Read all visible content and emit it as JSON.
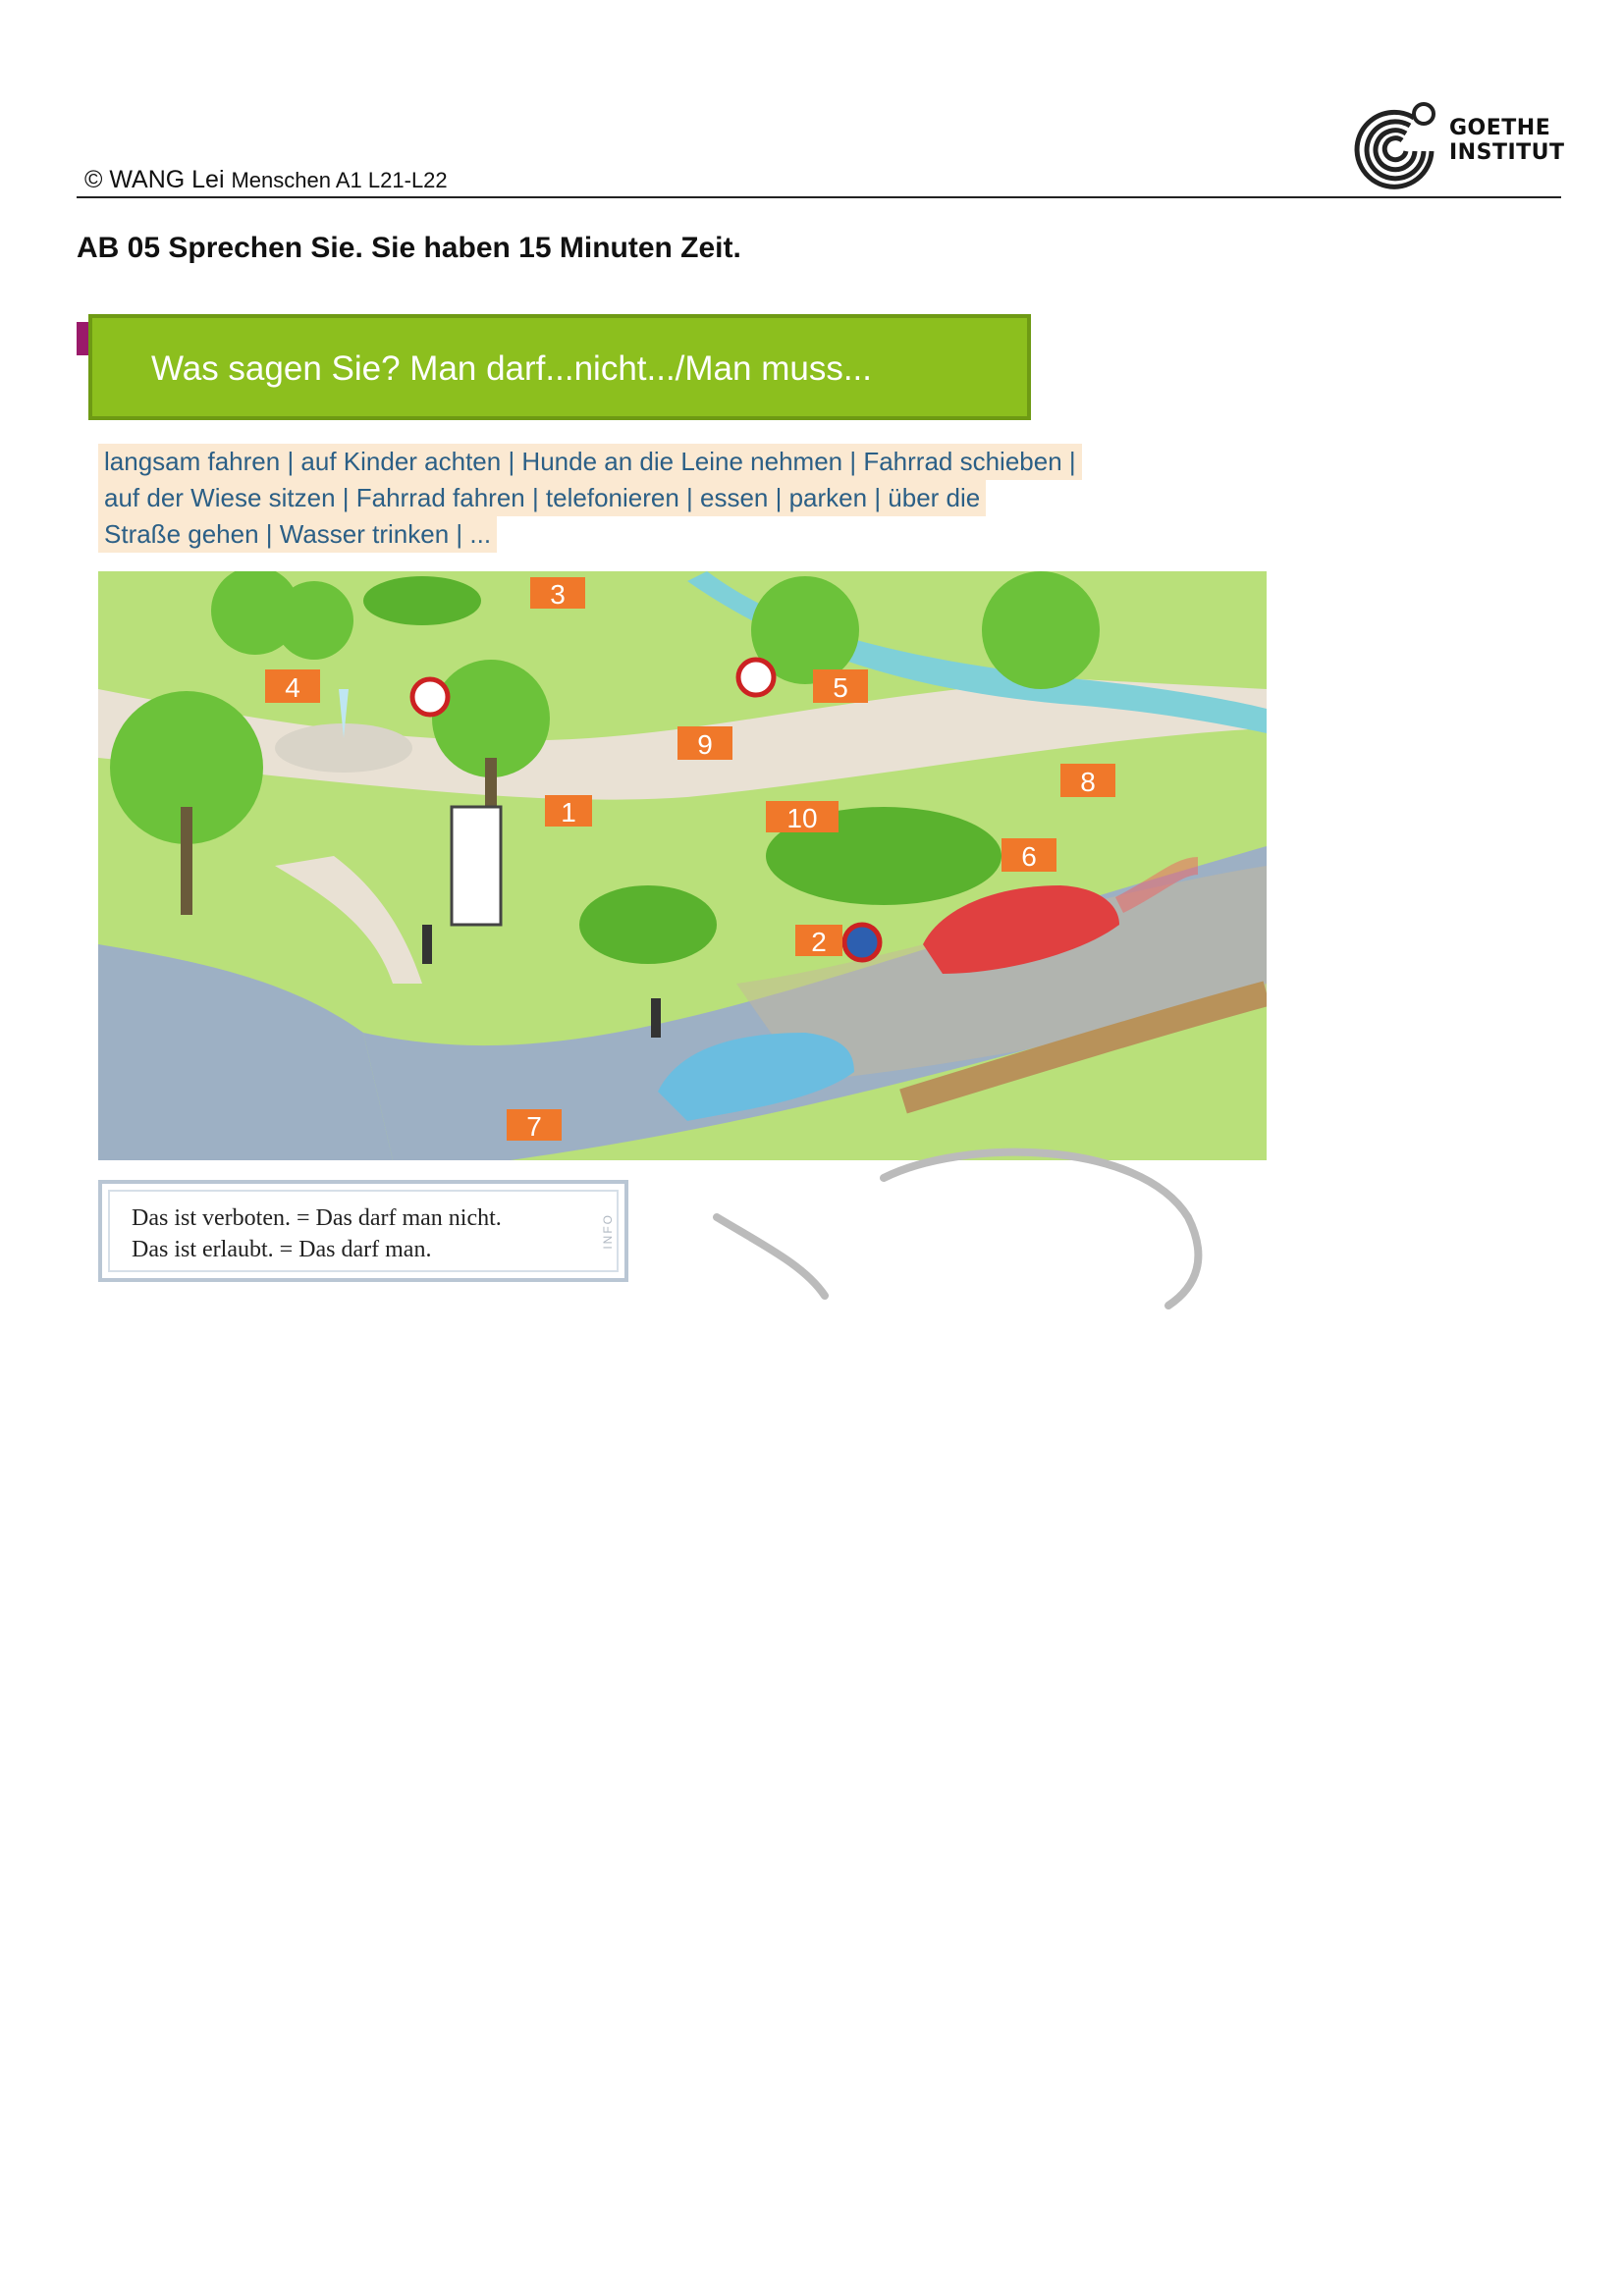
{
  "header": {
    "copyright": "© WANG Lei",
    "course": "Menschen A1 L21-L22",
    "logo_line1": "GOETHE",
    "logo_line2": "INSTITUT"
  },
  "task": {
    "title": "AB 05 Sprechen Sie. Sie haben 15 Minuten Zeit."
  },
  "banner": {
    "text": "Was sagen Sie? Man darf...nicht.../Man muss..."
  },
  "vocab": {
    "lines": [
      "langsam fahren | auf Kinder achten | Hunde an die Leine nehmen | Fahrrad schieben |",
      "auf der Wiese sitzen | Fahrrad fahren | telefonieren | essen | parken | über die",
      "Straße gehen | Wasser trinken | ..."
    ]
  },
  "scene": {
    "labels": [
      "1",
      "2",
      "3",
      "4",
      "5",
      "6",
      "7",
      "8",
      "9",
      "10"
    ]
  },
  "info": {
    "line1": "Das ist verboten. = Das darf man nicht.",
    "line2": "Das ist erlaubt. = Das darf man.",
    "tag": "INFO"
  },
  "colors": {
    "banner_green": "#8cbf1e",
    "label_orange": "#f0782a",
    "vocab_text": "#2b5f86",
    "vocab_bg": "#fbe9d2"
  }
}
